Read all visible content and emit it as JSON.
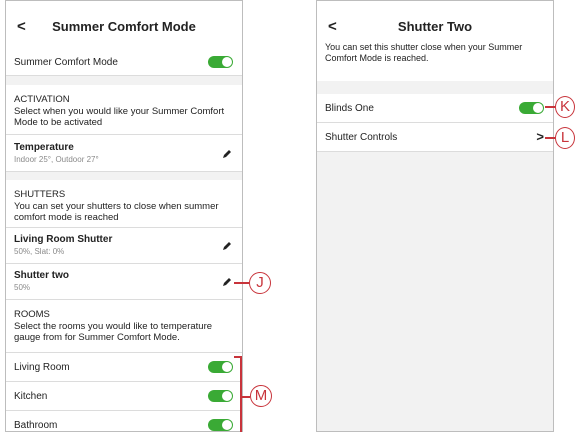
{
  "left": {
    "title": "Summer Comfort Mode",
    "back_glyph": "<",
    "mode_toggle_label": "Summer Comfort Mode",
    "activation": {
      "heading": "ACTIVATION",
      "description": "Select when you would like your Summer Comfort Mode to be activated",
      "item_title": "Temperature",
      "item_sub": "Indoor 25°, Outdoor 27°"
    },
    "shutters": {
      "heading": "SHUTTERS",
      "description": "You can set your shutters to close when summer comfort mode is reached",
      "items": [
        {
          "title": "Living Room Shutter",
          "sub": "50%, Slat: 0%"
        },
        {
          "title": "Shutter two",
          "sub": "50%"
        }
      ]
    },
    "rooms": {
      "heading": "ROOMS",
      "description": "Select the rooms you would like to temperature gauge from for Summer Comfort Mode.",
      "items": [
        {
          "label": "Living Room",
          "on": true
        },
        {
          "label": "Kitchen",
          "on": true
        },
        {
          "label": "Bathroom",
          "on": true
        }
      ]
    }
  },
  "right": {
    "title": "Shutter Two",
    "back_glyph": "<",
    "description": "You can set this shutter close when your Summer Comfort Mode is reached.",
    "blinds_label": "Blinds One",
    "blinds_on": true,
    "controls_label": "Shutter Controls",
    "chevron_glyph": ">"
  },
  "callouts": {
    "j": "J",
    "k": "K",
    "l": "L",
    "m": "M"
  },
  "colors": {
    "toggle_on": "#3aaa35",
    "callout": "#c8343b"
  },
  "icons": [
    "pencil-icon",
    "chevron-right-icon",
    "back-arrow-icon"
  ]
}
